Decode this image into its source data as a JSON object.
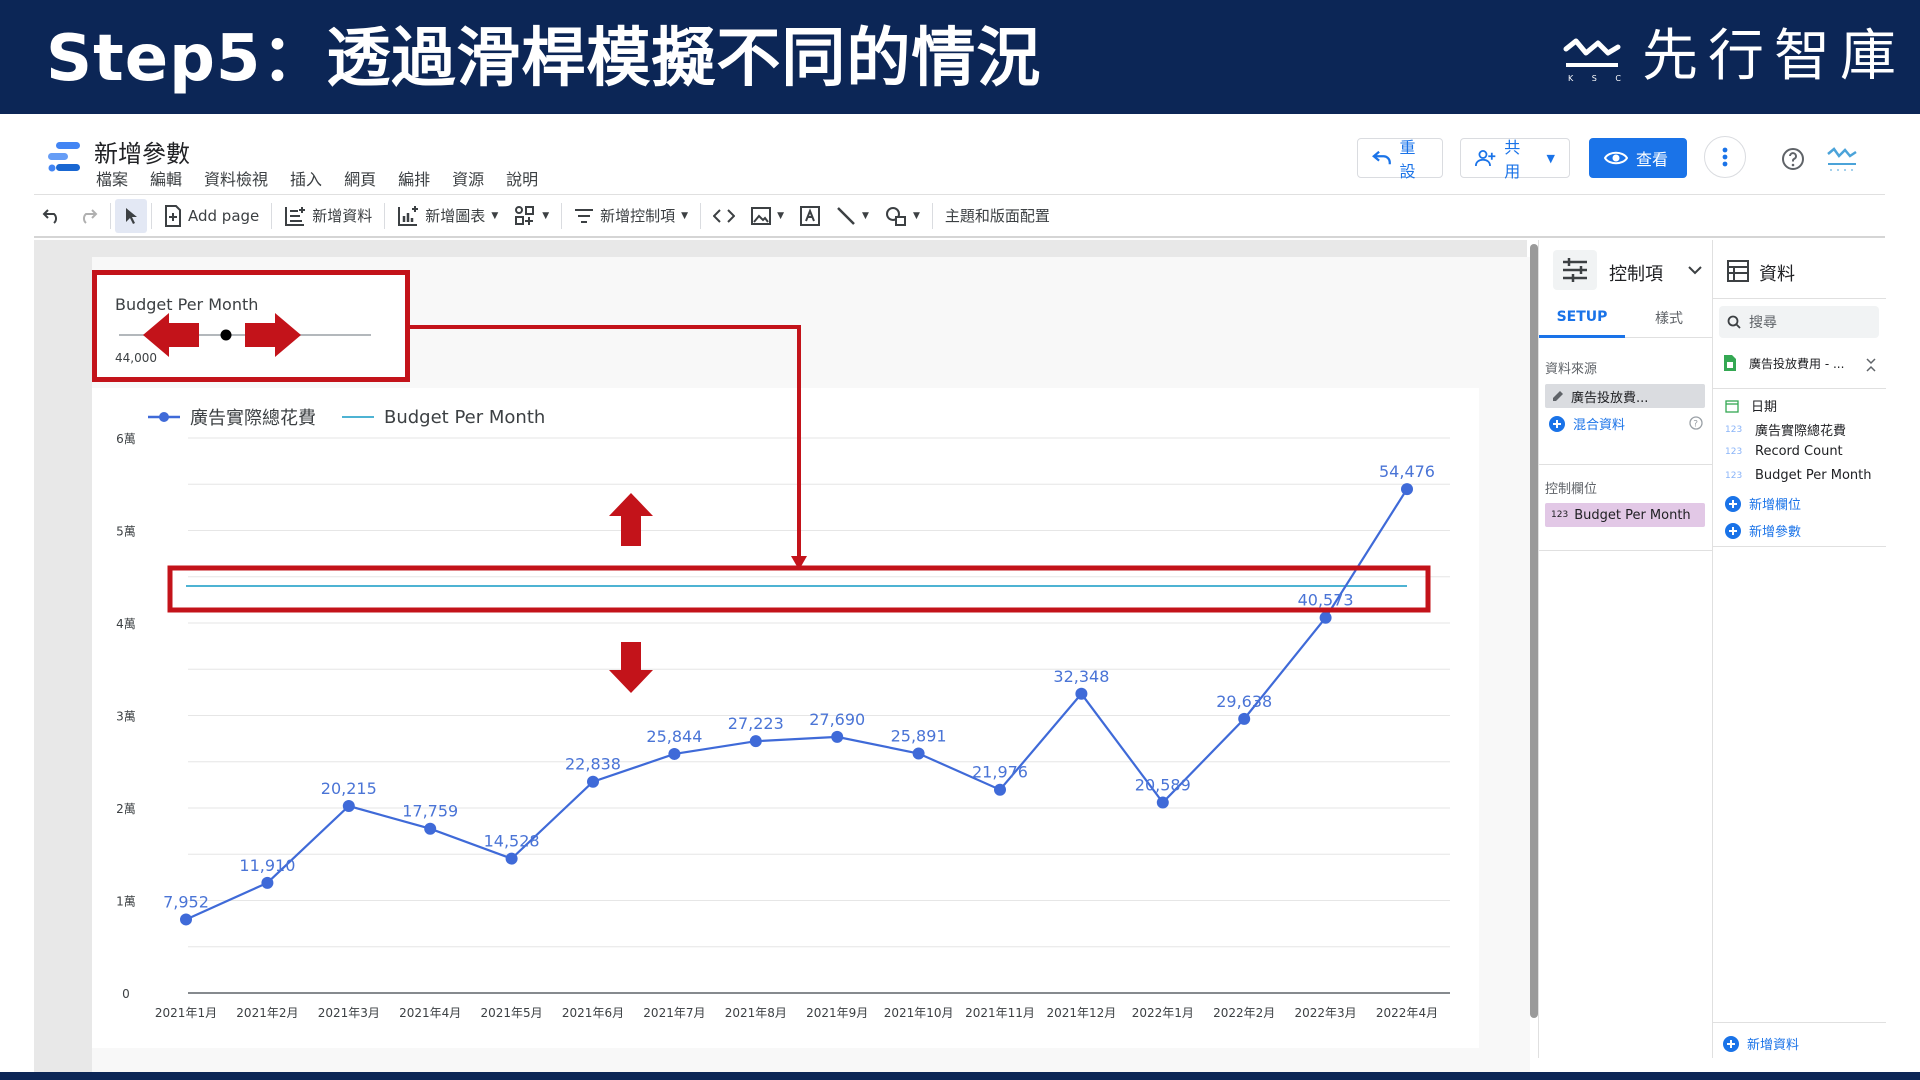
{
  "slide": {
    "title": "Step5：透過滑桿模擬不同的情況",
    "brand_name": "先行智庫",
    "brand_sub": "K S C C"
  },
  "app": {
    "doc_title": "新增參數",
    "menu": [
      "檔案",
      "編輯",
      "資料檢視",
      "插入",
      "網頁",
      "編排",
      "資源",
      "說明"
    ],
    "buttons": {
      "reset": "重設",
      "share": "共用",
      "view": "查看"
    }
  },
  "toolbar": {
    "add_page": "Add page",
    "add_data": "新增資料",
    "add_chart": "新增圖表",
    "add_control": "新增控制項",
    "theme_layout": "主題和版面配置"
  },
  "control": {
    "label": "Budget Per Month",
    "value_display": "44,000"
  },
  "legend": {
    "series1": "廣告實際總花費",
    "series2": "Budget Per Month"
  },
  "chart_data": {
    "type": "line",
    "categories": [
      "2021年1月",
      "2021年2月",
      "2021年3月",
      "2021年4月",
      "2021年5月",
      "2021年6月",
      "2021年7月",
      "2021年8月",
      "2021年9月",
      "2021年10月",
      "2021年11月",
      "2021年12月",
      "2022年1月",
      "2022年2月",
      "2022年3月",
      "2022年4月"
    ],
    "series": [
      {
        "name": "廣告實際總花費",
        "values": [
          7952,
          11910,
          20215,
          17759,
          14528,
          22838,
          25844,
          27223,
          27690,
          25891,
          21976,
          32348,
          20589,
          29638,
          40573,
          54476
        ],
        "color": "#3f6ad8"
      },
      {
        "name": "Budget Per Month",
        "values": [
          44000,
          44000,
          44000,
          44000,
          44000,
          44000,
          44000,
          44000,
          44000,
          44000,
          44000,
          44000,
          44000,
          44000,
          44000,
          44000
        ],
        "color": "#4eb3d3"
      }
    ],
    "data_labels": [
      "7,952",
      "11,910",
      "20,215",
      "17,759",
      "14,528",
      "22,838",
      "25,844",
      "27,223",
      "27,690",
      "25,891",
      "21,976",
      "32,348",
      "20,589",
      "29,638",
      "40,573",
      "54,476"
    ],
    "y_ticks": [
      0,
      10000,
      20000,
      30000,
      40000,
      50000,
      60000
    ],
    "y_tick_labels": [
      "0",
      "1萬",
      "2萬",
      "3萬",
      "4萬",
      "5萬",
      "6萬"
    ],
    "ylim": [
      0,
      60000
    ],
    "grid": true,
    "legend_position": "top-left"
  },
  "panel": {
    "controls_title": "控制項",
    "tab_setup": "SETUP",
    "tab_style": "樣式",
    "data_source_label": "資料來源",
    "data_source_chip": "廣告投放費...",
    "blend_link": "混合資料",
    "control_field_label": "控制欄位",
    "control_field_chip": "Budget Per Month",
    "control_field_badge": "123"
  },
  "data_panel": {
    "title": "資料",
    "search_placeholder": "搜尋",
    "source_name": "廣告投放費用 - ...",
    "fields": [
      {
        "badge": "",
        "name": "日期"
      },
      {
        "badge": "123",
        "name": "廣告實際總花費"
      },
      {
        "badge": "123",
        "name": "Record Count"
      },
      {
        "badge": "123",
        "name": "Budget Per Month"
      }
    ],
    "add_field": "新增欄位",
    "add_param": "新增參數",
    "add_data": "新增資料"
  }
}
